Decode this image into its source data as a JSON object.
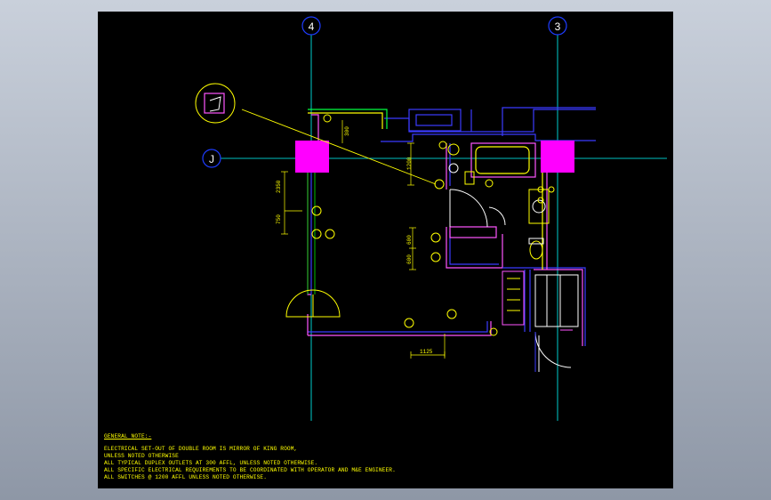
{
  "grid": {
    "col_4": "4",
    "col_3": "3",
    "row_j": "J"
  },
  "dimensions": {
    "d_300": "300",
    "d_1200": "1200",
    "d_2350": "2350",
    "d_750": "750",
    "d_600a": "600",
    "d_600b": "600",
    "d_1125": "1125"
  },
  "notes": {
    "heading": "GENERAL NOTE:-",
    "line1": "ELECTRICAL SET-OUT OF DOUBLE ROOM IS MIRROR OF KING ROOM,",
    "line2": "UNLESS NOTED OTHERWISE",
    "line3": "ALL TYPICAL DUPLEX OUTLETS AT 300 AFFL, UNLESS NOTED OTHERWISE.",
    "line4": "ALL SPECIFIC ELECTRICAL REQUIREMENTS TO BE COORDINATED  WITH OPERATOR AND M&E ENGINEER.",
    "line5": "ALL SWITCHES @ 1200 AFFL UNLESS NOTED OTHERWISE."
  },
  "colors": {
    "background": "#000000",
    "grid_line": "#00ffff",
    "bubble": "#1e3cff",
    "wall": "#ff55ff",
    "wall_outer": "#3b3bff",
    "fixture": "#ffff00",
    "green": "#00ff40",
    "column": "#ff00ff",
    "window": "#00c000",
    "note_text": "#ffff00"
  }
}
